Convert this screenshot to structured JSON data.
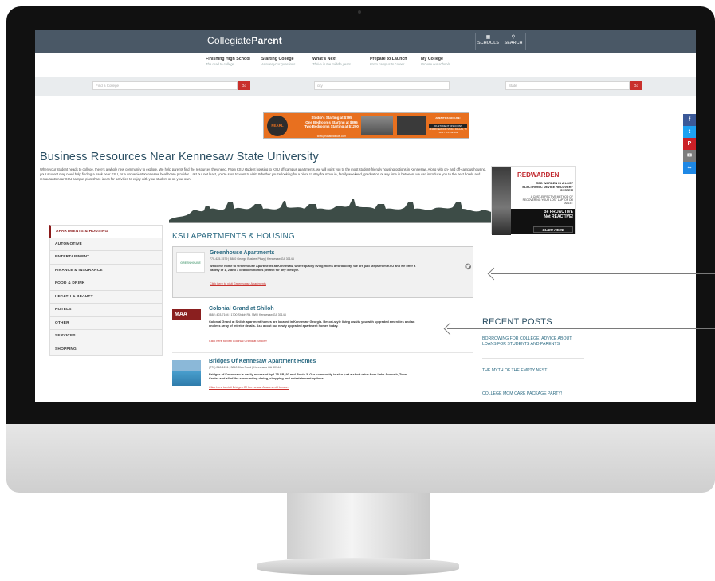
{
  "site": {
    "logo_prefix": "Collegiate",
    "logo_suffix": "Parent",
    "top_buttons": [
      {
        "icon": "building-icon",
        "glyph": "▦",
        "label": "SCHOOLS"
      },
      {
        "icon": "search-icon",
        "glyph": "⚲",
        "label": "SEARCH"
      }
    ]
  },
  "nav": [
    {
      "label": "Finishing High School",
      "sub": "The road to college"
    },
    {
      "label": "Starting College",
      "sub": "Answer your questions"
    },
    {
      "label": "What's Next",
      "sub": "Thrive in the middle years"
    },
    {
      "label": "Prepare to Launch",
      "sub": "From campus to career"
    },
    {
      "label": "My College",
      "sub": "Browse our schools"
    }
  ],
  "search": {
    "college_placeholder": "Find a College",
    "city_placeholder": "city",
    "state_placeholder": "State",
    "go_label": "Go"
  },
  "banner_ad": {
    "brand": "PEARL",
    "lines": [
      "Studio's Starting at $795",
      "One Bedrooms Starting at $895",
      "Two Bedrooms Starting at $1200"
    ],
    "url": "www.pearlatmidtown.com",
    "amenities_title": "AMENITIES INCLUDE:",
    "discount": "5% STUDENT DISCOUNT",
    "address": "4444 ROSEWOOD ST #G • DALLAS, TX 75204 • 214-349-0688"
  },
  "page": {
    "title": "Business Resources Near Kennesaw State University",
    "intro": "When your student heads to college, there's a whole new community to explore. We help parents find the resources they need. From KSU student housing to KSU off-campus apartments, we will point you to the most student-friendly housing options in Kennesaw. Along with on- and off-campus housing, your student may need help finding a bank near KSU, or a convenient Kennesaw healthcare provider. Last but not least, you're sure to want to visit! Whether you're looking for a place to stay for move in, family weekend, graduation or any time in between, we can introduce you to the best hotels and restaurants near KSU campus plus share ideas for activities to enjoy with your student or on your own."
  },
  "right_ad": {
    "brand": "REDWARDEN",
    "tagline": "RED WARDEN IS A LOST ELECTRONIC DEVICE RECOVERY SYSTEM",
    "sub": "A COST-EFFECTIVE METHOD OF RECOVERING YOUR LOST LAPTOP OR TABLET",
    "proactive_1": "Be PROACTIVE",
    "proactive_2": "Not REACTIVE!",
    "cta": "CLICK HERE"
  },
  "social": [
    {
      "icon": "facebook-icon",
      "glyph": "f",
      "color": "#3b5998"
    },
    {
      "icon": "twitter-icon",
      "glyph": "t",
      "color": "#1da1f2"
    },
    {
      "icon": "pinterest-icon",
      "glyph": "P",
      "color": "#cb2027"
    },
    {
      "icon": "email-icon",
      "glyph": "✉",
      "color": "#7d7d7d"
    },
    {
      "icon": "link-icon",
      "glyph": "∞",
      "color": "#1e88e5"
    }
  ],
  "categories": [
    "APARTMENTS & HOUSING",
    "AUTOMOTIVE",
    "ENTERTAINMENT",
    "FINANCE & INSURANCE",
    "FOOD & DRINK",
    "HEALTH & BEAUTY",
    "HOTELS",
    "OTHER",
    "SERVICES",
    "SHOPPING"
  ],
  "section_title": "KSU APARTMENTS & HOUSING",
  "listings": [
    {
      "name": "Greenhouse Apartments",
      "meta": "770-425-1579 | 3880 George Busbee Pkwy | Kennesaw GA 30144",
      "desc": "Welcome home to Greenhouse Apartments at Kennesaw, where quality living meets affordability. We are just steps from KSU and we offer a variety of 1, 2 and 3 bedroom homes perfect for any lifestyle.",
      "link": "Click here to visit Greenhouse Apartments",
      "thumb": "GREENHOUSE"
    },
    {
      "name": "Colonial Grand at Shiloh",
      "meta": "(888) 403-7104 | 1700 Shiloh Rd. NW | Kennesaw GA 30144",
      "desc": "Colonial Grand at Shiloh apartment homes are located in Kennesaw Georgia. Resort-style living awaits you with upgraded amenities and an endless array of interior details. Ask about our newly upgraded apartment homes today.",
      "link": "Click here to visit Colonial Grand at Shiloh»",
      "thumb": "MAA"
    },
    {
      "name": "Bridges Of Kennesaw Apartment Homes",
      "meta": "(770) 218-1201 | 3840 Jiles Road | Kennesaw GA 30144",
      "desc": "Bridges of Kennesaw is easily accessed by I-75 SR_92 and Route 3. Our community is also just a short drive from Lake Acworth, Town Center and all of the surrounding dining, shopping and entertainment options.",
      "link": "Click here to visit Bridges Of Kennesaw Apartment Homes»"
    }
  ],
  "recent_posts": {
    "title": "RECENT POSTS",
    "items": [
      "BORROWING FOR COLLEGE: ADVICE ABOUT LOANS FOR STUDENTS AND PARENTS",
      "THE MYTH OF THE EMPTY NEST",
      "COLLEGE MOM CARE PACKAGE PARTY!"
    ]
  },
  "colors": {
    "topbar": "#4a5866",
    "accent_red": "#c9302c",
    "title_blue": "#2b4f63",
    "link_blue": "#2b6a82"
  }
}
